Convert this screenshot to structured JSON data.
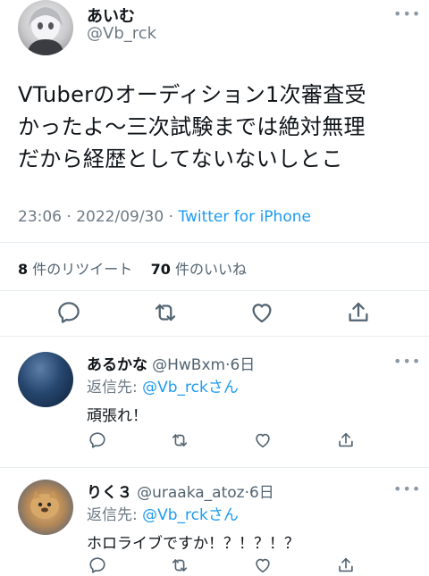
{
  "tweet": {
    "display_name": "あいむ",
    "handle": "@Vb_rck",
    "more_icon": "more-icon",
    "lines": [
      "VTuberのオーディション1次審査受",
      "かったよ〜三次試験までは絶対無理",
      "だから経歴としてないないしとこ"
    ],
    "time": "23:06 · 2022/09/30 · ",
    "source": "Twitter for iPhone",
    "retweet_count": "8",
    "retweet_label": "件のリツイート",
    "like_count": "70",
    "like_label": "件のいいね",
    "actions": [
      "reply-icon",
      "retweet-icon",
      "like-icon",
      "share-icon"
    ]
  },
  "replies": [
    {
      "name": "あるかな",
      "handle": "@HwBxm",
      "sep": "·",
      "time": "6日",
      "reply_to_label": "返信先: ",
      "reply_to_handle": "@Vb_rck",
      "reply_to_suffix": "さん",
      "text": "頑張れ！"
    },
    {
      "name": "りく３",
      "handle": "@uraaka_atoz",
      "sep": "·",
      "time": "6日",
      "reply_to_label": "返信先: ",
      "reply_to_handle": "@Vb_rck",
      "reply_to_suffix": "さん",
      "text": "ホロライブですか！？！？！？"
    }
  ],
  "colors": {
    "link": "#1d9bf0",
    "muted": "#536471",
    "divider": "#e6ecf0"
  }
}
